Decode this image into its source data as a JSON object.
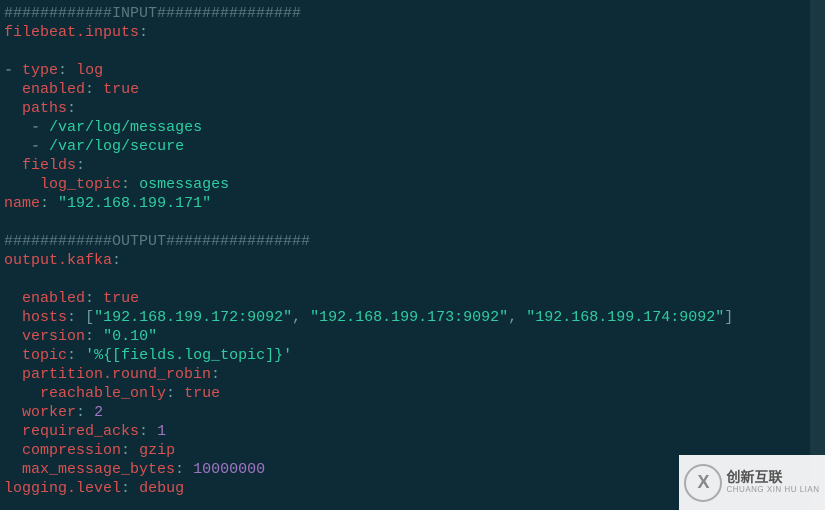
{
  "section_input_comment": "############INPUT################",
  "filebeat_inputs_key": "filebeat.inputs",
  "colon": ":",
  "dash": "-",
  "input": {
    "type_key": "type",
    "type_value": "log",
    "enabled_key": "enabled",
    "enabled_value": "true",
    "paths_key": "paths",
    "path1": "/var/log/messages",
    "path2": "/var/log/secure",
    "fields_key": "fields",
    "log_topic_key": "log_topic",
    "log_topic_value": "osmessages"
  },
  "name_key": "name",
  "name_value": "\"192.168.199.171\"",
  "section_output_comment": "############OUTPUT################",
  "output_kafka_key": "output.kafka",
  "kafka": {
    "enabled_key": "enabled",
    "enabled_value": "true",
    "hosts_key": "hosts",
    "hosts_open": "[",
    "host1": "\"192.168.199.172:9092\"",
    "comma": ",",
    "host2": "\"192.168.199.173:9092\"",
    "host3": "\"192.168.199.174:9092\"",
    "hosts_close": "]",
    "version_key": "version",
    "version_value": "\"0.10\"",
    "topic_key": "topic",
    "topic_value": "'%{[fields.log_topic]}'",
    "partition_key": "partition.round_robin",
    "reachable_only_key": "reachable_only",
    "reachable_only_value": "true",
    "worker_key": "worker",
    "worker_value": "2",
    "required_acks_key": "required_acks",
    "required_acks_value": "1",
    "compression_key": "compression",
    "compression_value": "gzip",
    "max_message_bytes_key": "max_message_bytes",
    "max_message_bytes_value": "10000000"
  },
  "logging_level_key": "logging.level",
  "logging_level_value": "debug",
  "watermark": {
    "logo_letter": "X",
    "line1": "创新互联",
    "line2": "CHUANG XIN HU LIAN"
  }
}
